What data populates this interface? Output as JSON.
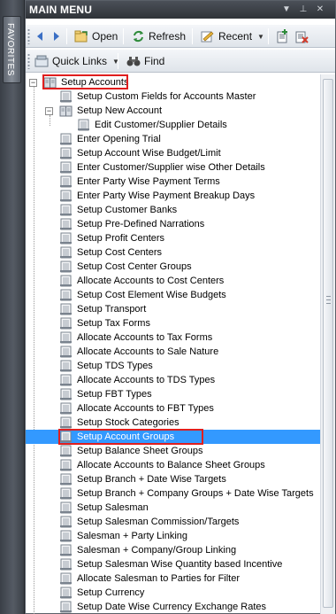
{
  "favorites_tab": {
    "label": "FAVORITES"
  },
  "panel": {
    "title": "MAIN MENU",
    "controls": {
      "dropdown": "▼",
      "pin": "⊥",
      "close": "✕"
    }
  },
  "toolbar": {
    "back_icon": "back-arrow-icon",
    "forward_icon": "forward-arrow-icon",
    "open_label": "Open",
    "refresh_label": "Refresh",
    "recent_label": "Recent",
    "quick_links_label": "Quick Links",
    "find_label": "Find"
  },
  "tree": {
    "root": "Setup Accounts",
    "child_custom_fields": "Setup Custom Fields for Accounts Master",
    "new_account": "Setup New Account",
    "edit_customer": "Edit Customer/Supplier Details",
    "items": [
      "Enter Opening Trial",
      "Setup Account Wise Budget/Limit",
      "Enter Customer/Supplier wise Other Details",
      "Enter Party Wise Payment Terms",
      "Enter Party Wise Payment Breakup Days",
      "Setup Customer Banks",
      "Setup Pre-Defined Narrations",
      "Setup Profit Centers",
      "Setup Cost Centers",
      "Setup Cost Center Groups",
      "Allocate Accounts to Cost Centers",
      "Setup Cost Element Wise Budgets",
      "Setup Transport",
      "Setup Tax Forms",
      "Allocate Accounts to Tax Forms",
      "Allocate Accounts to Sale Nature",
      "Setup TDS Types",
      "Allocate Accounts to TDS Types",
      "Setup FBT Types",
      "Allocate Accounts to FBT Types",
      "Setup Stock Categories",
      "Setup Account Groups",
      "Setup Balance Sheet Groups",
      "Allocate Accounts to Balance Sheet Groups",
      "Setup Branch + Date Wise Targets",
      "Setup Branch + Company Groups + Date Wise Targets",
      "Setup Salesman",
      "Setup Salesman Commission/Targets",
      "Salesman + Party Linking",
      "Salesman + Company/Group Linking",
      "Setup Salesman Wise Quantity based Incentive",
      "Allocate Salesman to Parties for Filter",
      "Setup Currency",
      "Setup Date Wise Currency Exchange Rates"
    ],
    "selected_item": "Setup Account Groups"
  },
  "colors": {
    "selection": "#3399ff",
    "highlight_box": "#e01e1e",
    "title_bar": "#3a3f46"
  }
}
